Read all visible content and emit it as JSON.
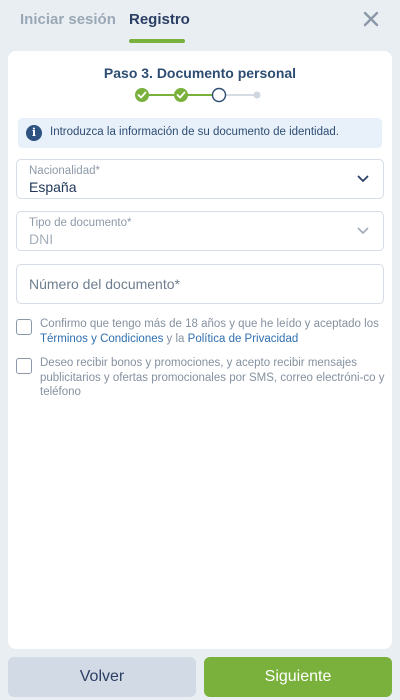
{
  "header": {
    "tabs": [
      {
        "label": "Iniciar sesión",
        "active": false
      },
      {
        "label": "Registro",
        "active": true
      }
    ],
    "accent_color": "#7ab13c"
  },
  "step": {
    "title": "Paso 3. Documento personal",
    "total": 4,
    "completed": 2,
    "current": 3
  },
  "info": {
    "icon": "info-icon",
    "text": "Introduzca la información de su documento de identidad."
  },
  "form": {
    "nationality": {
      "label": "Nacionalidad*",
      "value": "España"
    },
    "doc_type": {
      "label": "Tipo de documento*",
      "value": "DNI"
    },
    "doc_number": {
      "placeholder": "Número del documento*",
      "value": ""
    }
  },
  "consents": {
    "terms": {
      "pre": "Confirmo que tengo más de 18 años y que he leído y aceptado los ",
      "link1": "Términos y Condiciones",
      "mid": " y la ",
      "link2": "Política de Privacidad",
      "checked": false
    },
    "marketing": {
      "text": "Deseo recibir bonos y promociones, y acepto recibir mensajes publicitarios y ofertas promocionales por SMS, correo electróni-co y teléfono",
      "checked": false
    }
  },
  "footer": {
    "back_label": "Volver",
    "next_label": "Siguiente"
  }
}
